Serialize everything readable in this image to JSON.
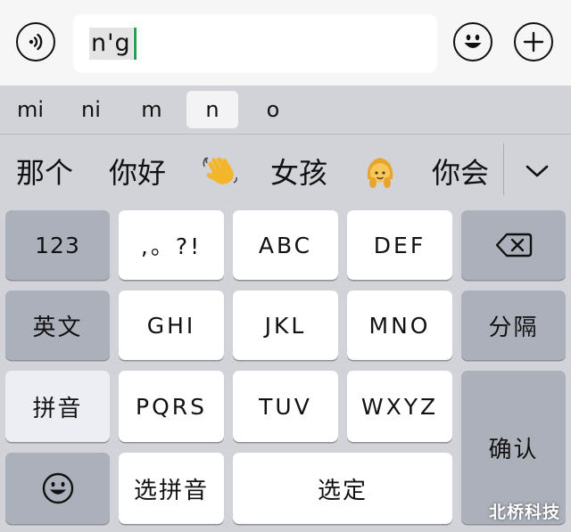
{
  "input": {
    "composed_text": "n'g"
  },
  "pinyin_options": [
    "mi",
    "ni",
    "m",
    "n",
    "o"
  ],
  "pinyin_selected": "n",
  "candidates": {
    "c1": "那个",
    "c2": "你好",
    "c3_emoji": "👋",
    "c4": "女孩",
    "c5_emoji": "👧",
    "c6": "你会"
  },
  "keys": {
    "num": "123",
    "punct": ",。?!",
    "abc": "ABC",
    "def": "DEF",
    "english": "英文",
    "ghi": "GHI",
    "jkl": "JKL",
    "mno": "MNO",
    "separator": "分隔",
    "pinyin": "拼音",
    "pqrs": "PQRS",
    "tuv": "TUV",
    "wxyz": "WXYZ",
    "confirm": "确认",
    "select_pinyin": "选拼音",
    "select": "选定"
  },
  "watermark": "北桥科技",
  "colors": {
    "caret": "#2e9b53",
    "key_white": "#ffffff",
    "key_gray": "#abb0ba",
    "keyboard_bg": "#d1d3d9"
  }
}
